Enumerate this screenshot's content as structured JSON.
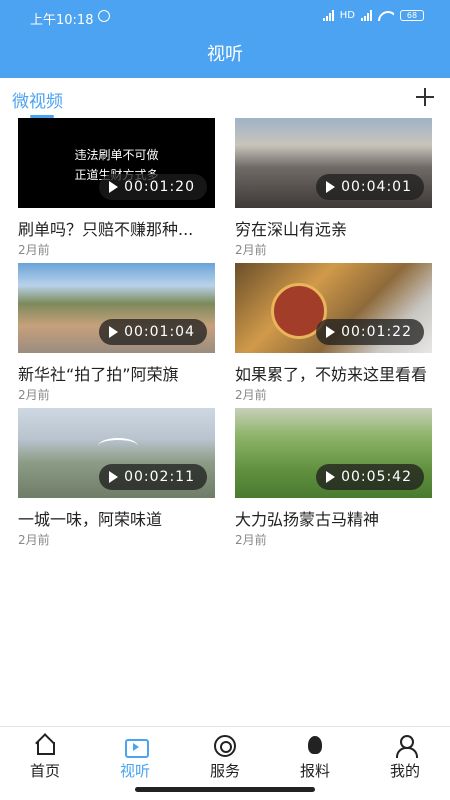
{
  "status_bar": {
    "time": "上午10:18",
    "network": "HD",
    "battery": "68"
  },
  "header": {
    "title": "视听"
  },
  "tabs": {
    "active": "微视频"
  },
  "videos": [
    {
      "title": "刷单吗？只赔不赚那种...",
      "time": "2月前",
      "duration": "00:01:20",
      "overlay": [
        "违法刷单不可做",
        "正道生财方式多"
      ]
    },
    {
      "title": "穷在深山有远亲",
      "time": "2月前",
      "duration": "00:04:01",
      "overlay": []
    },
    {
      "title": "新华社“拍了拍”阿荣旗",
      "time": "2月前",
      "duration": "00:01:04",
      "overlay": []
    },
    {
      "title": "如果累了，不妨来这里看看",
      "time": "2月前",
      "duration": "00:01:22",
      "overlay": []
    },
    {
      "title": "一城一味，阿荣味道",
      "time": "2月前",
      "duration": "00:02:11",
      "overlay": []
    },
    {
      "title": "大力弘扬蒙古马精神",
      "time": "2月前",
      "duration": "00:05:42",
      "overlay": []
    }
  ],
  "bottom_nav": [
    {
      "label": "首页",
      "icon": "home-icon"
    },
    {
      "label": "视听",
      "icon": "tv-icon"
    },
    {
      "label": "服务",
      "icon": "service-icon"
    },
    {
      "label": "报料",
      "icon": "fire-icon"
    },
    {
      "label": "我的",
      "icon": "user-icon"
    }
  ],
  "colors": {
    "accent": "#4ba3f2"
  }
}
